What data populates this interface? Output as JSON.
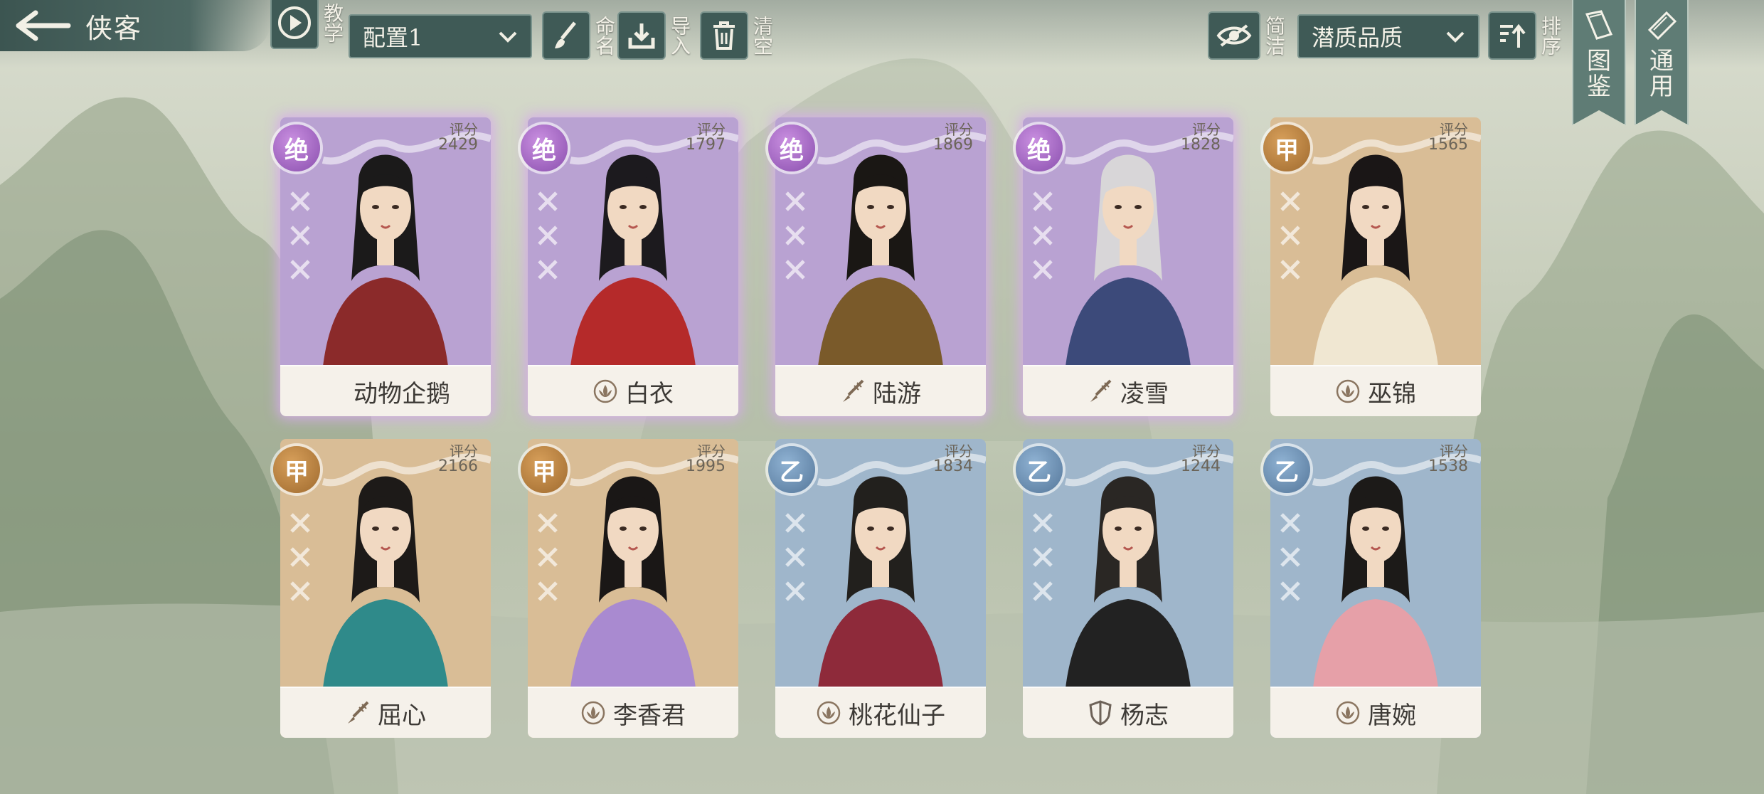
{
  "header": {
    "title": "侠客",
    "tutorial_label": "教学",
    "config_select": "配置1",
    "rename_label": "命名",
    "import_label": "导入",
    "clear_label": "清空",
    "simple_label": "简洁",
    "sort_select": "潜质品质",
    "sort_label": "排序",
    "gallery_label": "图鉴",
    "general_label": "通用"
  },
  "score_label": "评分",
  "cards": [
    {
      "name": "动物企鹅",
      "grade": "绝",
      "score": "2429",
      "quality": "jue",
      "class_icon": "none"
    },
    {
      "name": "白衣",
      "grade": "绝",
      "score": "1797",
      "quality": "jue",
      "class_icon": "lotus-icon"
    },
    {
      "name": "陆游",
      "grade": "绝",
      "score": "1869",
      "quality": "jue",
      "class_icon": "brush-icon"
    },
    {
      "name": "凌雪",
      "grade": "绝",
      "score": "1828",
      "quality": "jue",
      "class_icon": "brush-icon"
    },
    {
      "name": "巫锦",
      "grade": "甲",
      "score": "1565",
      "quality": "jia",
      "class_icon": "lotus-icon"
    },
    {
      "name": "屈心",
      "grade": "甲",
      "score": "2166",
      "quality": "jia",
      "class_icon": "brush-icon"
    },
    {
      "name": "李香君",
      "grade": "甲",
      "score": "1995",
      "quality": "jia",
      "class_icon": "lotus-icon"
    },
    {
      "name": "桃花仙子",
      "grade": "乙",
      "score": "1834",
      "quality": "yi",
      "class_icon": "lotus-icon"
    },
    {
      "name": "杨志",
      "grade": "乙",
      "score": "1244",
      "quality": "yi",
      "class_icon": "shield-icon"
    },
    {
      "name": "唐婉",
      "grade": "乙",
      "score": "1538",
      "quality": "yi",
      "class_icon": "lotus-icon"
    }
  ],
  "colors": {
    "jue": "#b9a2d2",
    "jia": "#d9bd96",
    "yi": "#9fb6cb",
    "toolbar": "#3f5a56"
  }
}
